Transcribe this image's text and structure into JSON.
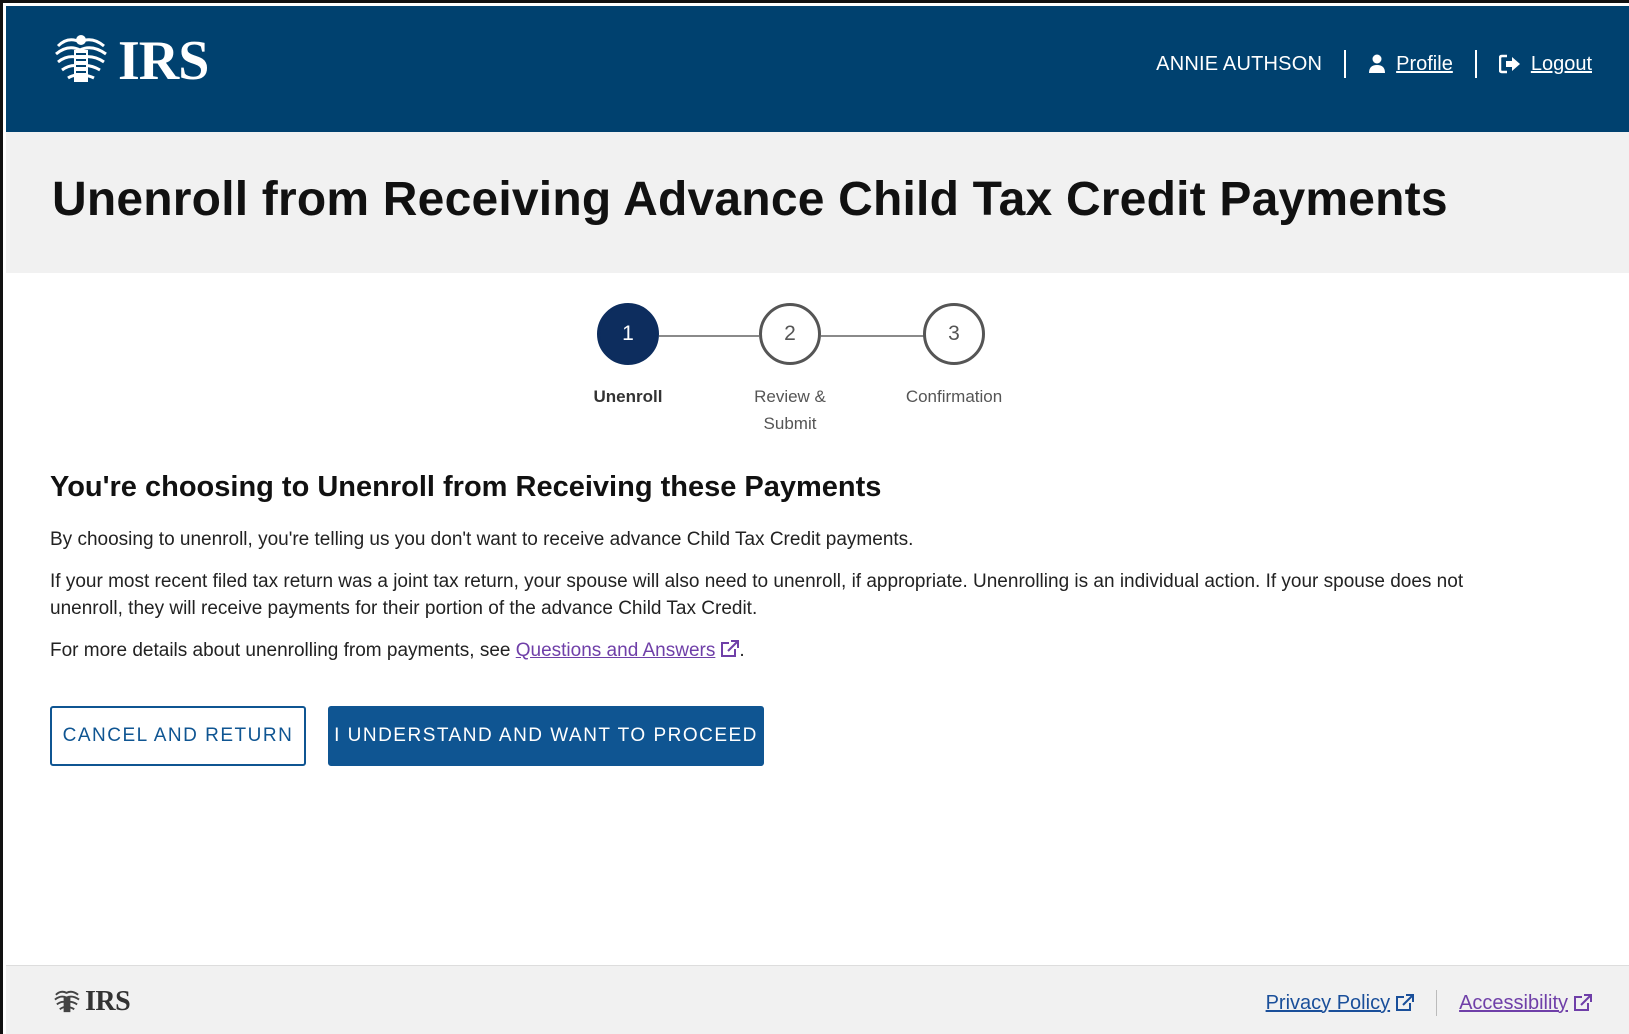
{
  "header": {
    "logo_text": "IRS",
    "username": "ANNIE AUTHSON",
    "profile_label": "Profile",
    "logout_label": "Logout"
  },
  "page": {
    "title": "Unenroll from Receiving Advance Child Tax Credit Payments"
  },
  "stepper": {
    "steps": [
      {
        "number": "1",
        "label_line1": "Unenroll",
        "label_line2": "",
        "state": "active"
      },
      {
        "number": "2",
        "label_line1": "Review &",
        "label_line2": "Submit",
        "state": "todo"
      },
      {
        "number": "3",
        "label_line1": "Confirmation",
        "label_line2": "",
        "state": "todo"
      }
    ]
  },
  "content": {
    "section_title": "You're choosing to Unenroll from Receiving these Payments",
    "para1": "By choosing to unenroll, you're telling us you don't want to receive advance Child Tax Credit payments.",
    "para2_line1": "If your most recent filed tax return was a joint tax return, your spouse will also need to unenroll, if appropriate. Unenrolling is an individual action. If your spouse does not",
    "para2_line2": "unenroll, they will receive payments for their portion of the advance Child Tax Credit.",
    "para3_prefix": "For more details about unenrolling from payments, see ",
    "para3_link": "Questions and Answers",
    "para3_suffix": "."
  },
  "actions": {
    "cancel_label": "CANCEL AND RETURN",
    "proceed_label": "I UNDERSTAND AND WANT TO PROCEED"
  },
  "footer": {
    "logo_text": "IRS",
    "privacy_label": "Privacy Policy",
    "accessibility_label": "Accessibility"
  },
  "colors": {
    "header_bg": "#00416f",
    "primary_button": "#0f5592",
    "step_active": "#0d2d5e",
    "visited_link": "#6f3fa8"
  }
}
